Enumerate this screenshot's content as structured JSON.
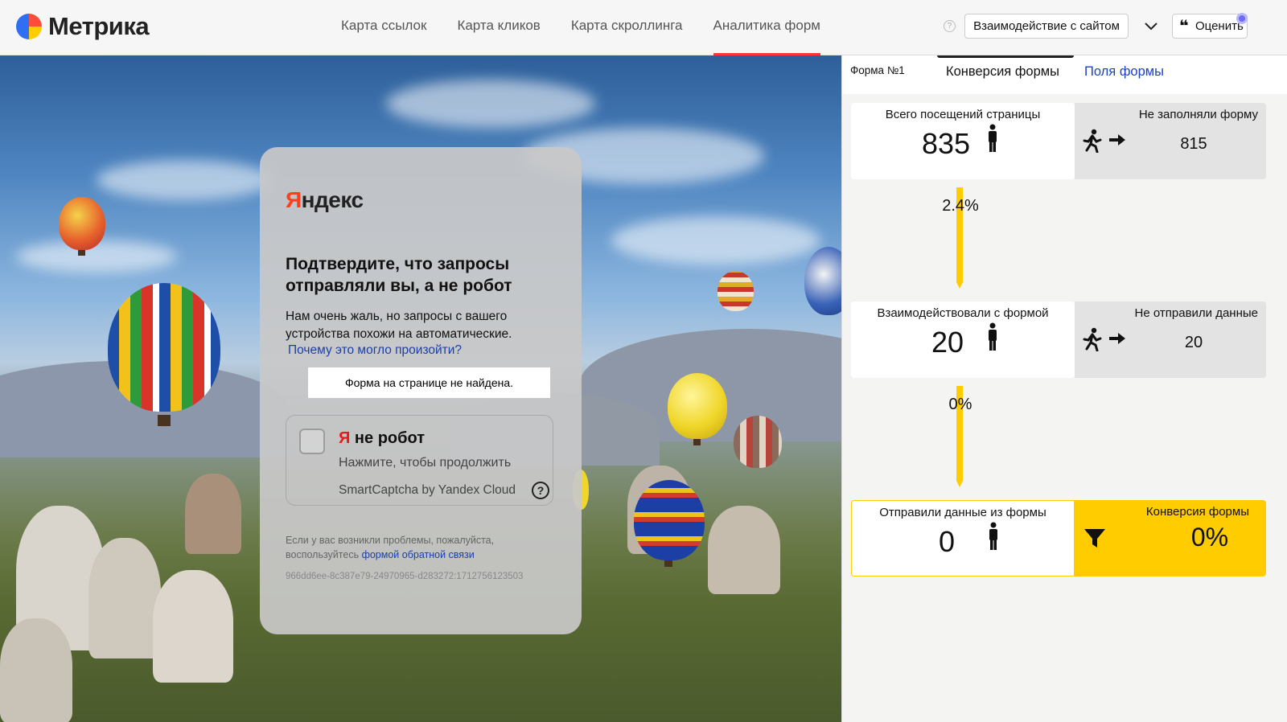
{
  "header": {
    "logo_text": "Метрика",
    "nav": [
      {
        "label": "Карта ссылок"
      },
      {
        "label": "Карта кликов"
      },
      {
        "label": "Карта скроллинга"
      },
      {
        "label": "Аналитика форм",
        "active": true
      }
    ],
    "help_icon": "?",
    "interact_label": "Взаимодействие с сайтом",
    "rate_label": "Оценить"
  },
  "captcha": {
    "brand_first": "Я",
    "brand_rest": "ндекс",
    "title": "Подтвердите, что запросы отправляли вы, а не робот",
    "text": "Нам очень жаль, но запросы с вашего устройства похожи на автоматические.",
    "why_link": "Почему это могло произойти?",
    "form_not_found": "Форма на странице не найдена.",
    "robot_ya": "Я",
    "robot_rest": " не робот",
    "robot_sub": "Нажмите, чтобы продолжить",
    "robot_brand": "SmartCaptcha by Yandex Cloud",
    "robot_help": "?",
    "footer_text": "Если у вас возникли проблемы, пожалуйста, воспользуйтесь",
    "footer_link": "формой обратной связи",
    "request_id": "966dd6ee-8c387e79-24970965-d283272:1712756123503"
  },
  "panel": {
    "form_label": "Форма №1",
    "tab_conversion": "Конверсия формы",
    "tab_fields": "Поля формы",
    "stats": [
      {
        "label": "Всего посещений страницы",
        "value": "835",
        "side_label": "Не заполняли форму",
        "side_value": "815"
      },
      {
        "label": "Взаимодействовали с формой",
        "value": "20",
        "side_label": "Не отправили данные",
        "side_value": "20"
      },
      {
        "label": "Отправили данные из формы",
        "value": "0",
        "side_label": "Конверсия формы",
        "side_value": "0%"
      }
    ],
    "percents": [
      "2.4%",
      "0%"
    ],
    "colors": {
      "accent": "#ffcc00",
      "link": "#1a3fd0",
      "active_tab": "#ff3333"
    }
  }
}
